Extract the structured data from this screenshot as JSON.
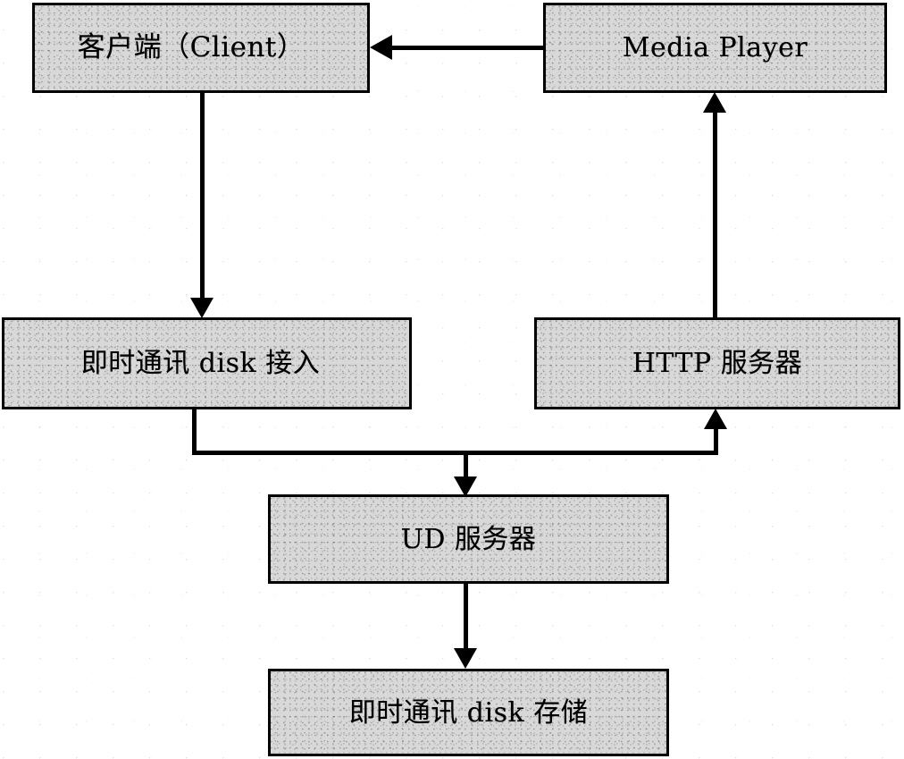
{
  "diagram": {
    "type": "block-flow-diagram",
    "background_color": "#ffffff",
    "node_fill_color": "#d8d8d8",
    "stroke_color": "#000000",
    "nodes": [
      {
        "id": "client",
        "label": "客户端（Client）"
      },
      {
        "id": "media",
        "label": "Media Player"
      },
      {
        "id": "im_access",
        "label": "即时通讯 disk 接入"
      },
      {
        "id": "http",
        "label": "HTTP 服务器"
      },
      {
        "id": "ud",
        "label": "UD 服务器"
      },
      {
        "id": "storage",
        "label": "即时通讯 disk 存储"
      }
    ],
    "edges": [
      {
        "from": "media",
        "to": "client",
        "direction": "left",
        "style": "solid"
      },
      {
        "from": "client",
        "to": "im_access",
        "direction": "down",
        "style": "solid"
      },
      {
        "from": "http",
        "to": "media",
        "direction": "up",
        "style": "solid"
      },
      {
        "from": "im_access",
        "to": "ud",
        "direction": "down",
        "style": "solid"
      },
      {
        "from": "im_access",
        "to": "http",
        "direction": "up",
        "style": "solid"
      },
      {
        "from": "ud",
        "to": "storage",
        "direction": "down",
        "style": "solid"
      }
    ]
  }
}
